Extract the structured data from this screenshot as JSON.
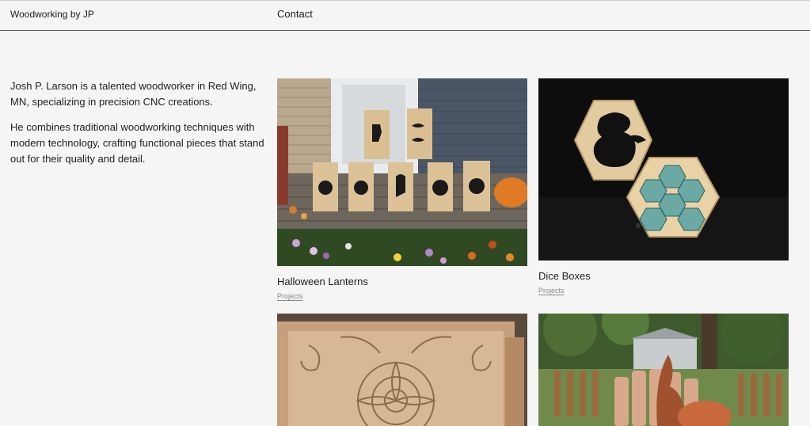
{
  "header": {
    "site_title": "Woodworking by JP",
    "nav": [
      {
        "label": "Contact"
      }
    ]
  },
  "intro": {
    "paragraphs": [
      "Josh P. Larson is a talented woodworker in Red Wing, MN, specializing in precision CNC creations.",
      "He combines traditional woodworking techniques with modern technology, crafting functional pieces that stand out for their quality and detail."
    ]
  },
  "projects": [
    {
      "title": "Halloween Lanterns",
      "category": "Projects"
    },
    {
      "title": "Dice Boxes",
      "category": "Projects"
    },
    {
      "title": "",
      "category": ""
    },
    {
      "title": "",
      "category": ""
    }
  ]
}
